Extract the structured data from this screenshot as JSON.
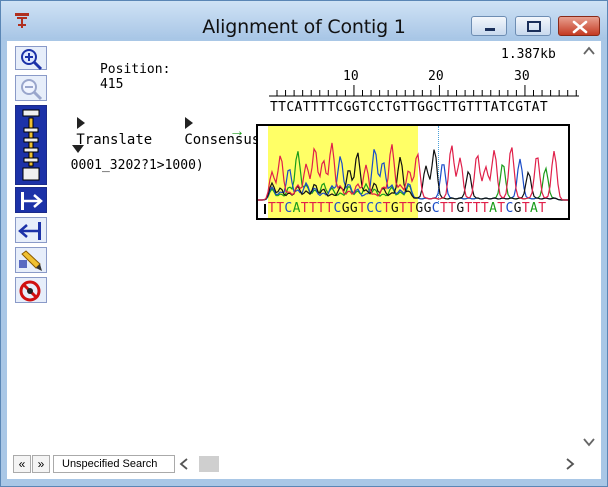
{
  "window": {
    "title": "Alignment of Contig 1"
  },
  "header": {
    "position_label": "Position:",
    "position_value": "415",
    "length": "1.387kb"
  },
  "ruler": {
    "ticks": [
      "10",
      "20",
      "30"
    ]
  },
  "rows": {
    "translate_label": "Translate",
    "consensus_label": "Consensus",
    "consensus_sequence": "TTCATTTTCGGTCCTGTTGGCTTGTTTATCGTAT",
    "read_name": "0001_3202?1>1000)",
    "read_arrow": "→",
    "read_sequence": "TTCATTTTCGGTCCTGTTGGCTTGTTTATCGTAT"
  },
  "colors": {
    "highlight": "#ffff66",
    "base_A": "#1a9c1a",
    "base_C": "#1a4cc8",
    "base_G": "#111111",
    "base_T": "#e0204a"
  },
  "toolbar": {
    "tools": [
      "zoom-in-icon",
      "zoom-out-icon",
      "slider-icon",
      "go-right-icon",
      "go-left-icon",
      "pencil-icon",
      "stop-icon"
    ]
  },
  "bottom": {
    "search_label": "Unspecified Search",
    "prev_label": "«",
    "next_label": "»"
  }
}
